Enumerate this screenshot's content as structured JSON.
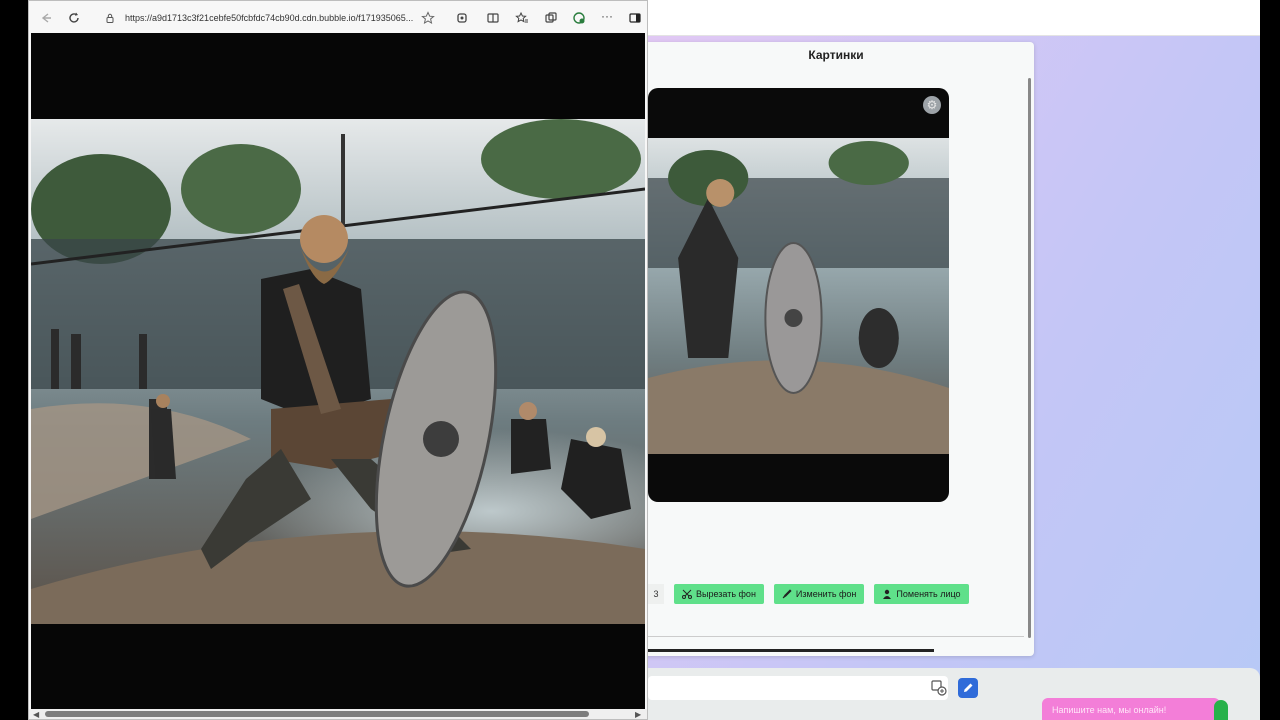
{
  "browser": {
    "url": "https://a9d1713c3f21cebfe50fcbfdc74cb90d.cdn.bubble.io/f171935065...",
    "icons": [
      "back-icon",
      "reload-icon",
      "lock-icon",
      "star-icon",
      "extensions-icon",
      "split-screen-icon",
      "favorites-icon",
      "collections-icon",
      "copilot-icon",
      "more-icon",
      "sidebar-icon"
    ]
  },
  "card": {
    "title": "Картинки",
    "page_number": "3",
    "buttons": {
      "cut_bg": "Вырезать фон",
      "change_bg": "Изменить фон",
      "swap_face": "Поменять лицо"
    }
  },
  "chat": {
    "label": "Напишите нам, мы онлайн!"
  },
  "colors": {
    "accent_green": "#5fe08a",
    "pencil_blue": "#2f6bd9",
    "chat_pink": "#f37ed8"
  }
}
